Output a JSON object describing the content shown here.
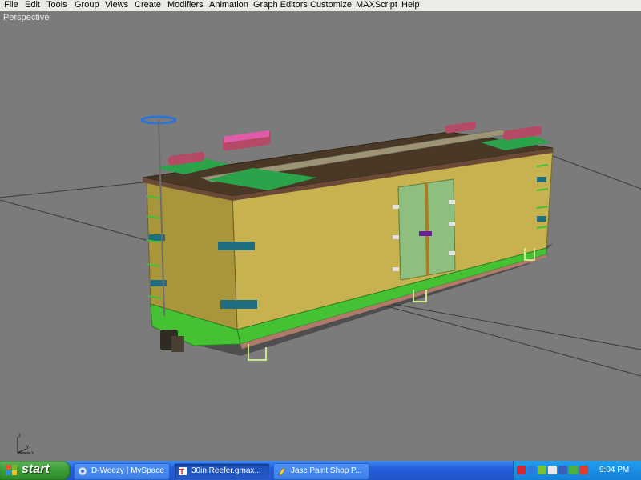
{
  "menu": [
    "File",
    "Edit",
    "Tools",
    "Group",
    "Views",
    "Create",
    "Modifiers",
    "Animation",
    "Graph Editors",
    "Customize",
    "MAXScript",
    "Help"
  ],
  "viewport": {
    "label": "Perspective",
    "axes": {
      "x": "x",
      "y": "y",
      "z": "z"
    }
  },
  "taskbar": {
    "start_label": "start",
    "tasks": [
      {
        "label": "D-Weezy | MySpace",
        "icon": "browser-icon",
        "active": false
      },
      {
        "label": "30in Reefer.gmax...",
        "icon": "gmax-icon",
        "active": true
      },
      {
        "label": "Jasc Paint Shop P...",
        "icon": "paint-shop-icon",
        "active": false
      }
    ],
    "clock": "9:04 PM"
  },
  "colors": {
    "menubar": "#ecebe6",
    "viewport_bg": "#7b7b7b",
    "car_body": "#c8b24f",
    "car_body_shade": "#a08c35",
    "underframe": "#44c234",
    "door": "#8fbf7e",
    "taskbar": "#245edb",
    "start_button": "#3a9b36"
  }
}
